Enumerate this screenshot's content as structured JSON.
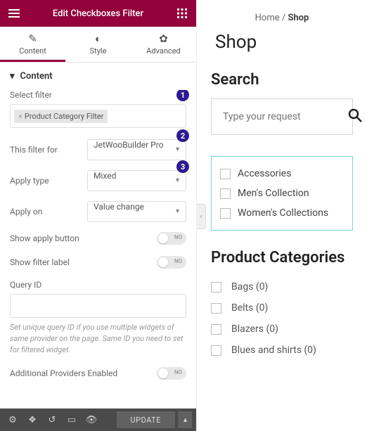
{
  "header": {
    "title": "Edit Checkboxes Filter"
  },
  "tabs": {
    "content": "Content",
    "style": "Style",
    "advanced": "Advanced"
  },
  "section": {
    "title": "Content"
  },
  "labels": {
    "select_filter": "Select filter",
    "this_filter_for": "This filter for",
    "apply_type": "Apply type",
    "apply_on": "Apply on",
    "show_apply_button": "Show apply button",
    "show_filter_label": "Show filter label",
    "query_id": "Query ID",
    "additional_providers": "Additional Providers Enabled"
  },
  "values": {
    "filter_chip": "Product Category Filter",
    "this_filter_for": "JetWooBuilder Pro",
    "apply_type": "Mixed",
    "apply_on": "Value change"
  },
  "help": {
    "query_id": "Set unique query ID if you use multiple widgets of same provider on the page. Same ID you need to set for filtered widget."
  },
  "annotations": {
    "a1": "1",
    "a2": "2",
    "a3": "3"
  },
  "footer": {
    "update": "UPDATE"
  },
  "preview": {
    "crumb_home": "Home",
    "crumb_sep": " / ",
    "crumb_shop": "Shop",
    "title": "Shop",
    "search_heading": "Search",
    "search_placeholder": "Type your request",
    "filters": [
      "Accessories",
      "Men's Collection",
      "Women's Collections"
    ],
    "cat_heading": "Product Categories",
    "cats": [
      "Bags (0)",
      "Belts (0)",
      "Blazers (0)",
      "Blues and shirts (0)"
    ]
  }
}
